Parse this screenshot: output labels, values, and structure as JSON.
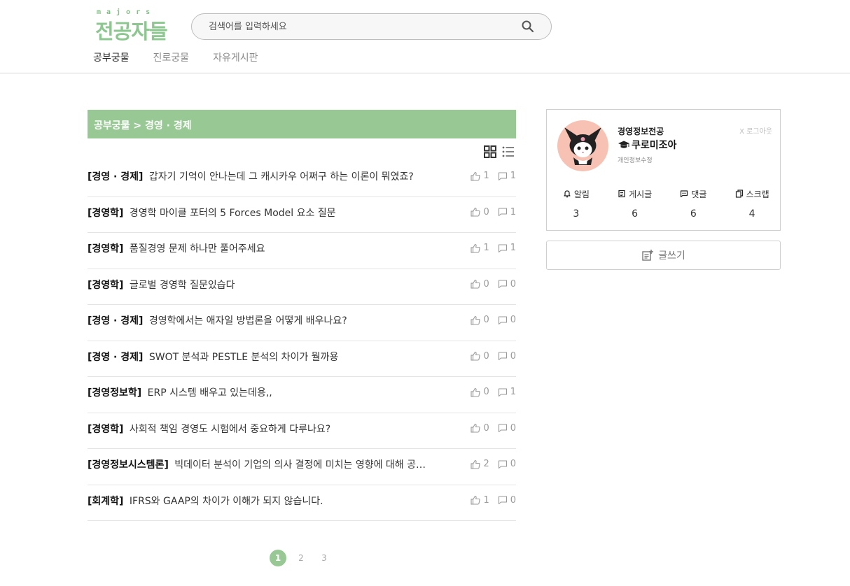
{
  "header": {
    "logo_sub": "majors",
    "logo_main": "전공자들",
    "search_placeholder": "검색어를 입력하세요"
  },
  "nav": [
    {
      "label": "공부궁물",
      "active": true
    },
    {
      "label": "진로궁물",
      "active": false
    },
    {
      "label": "자유게시판",
      "active": false
    }
  ],
  "board": {
    "breadcrumb": "공부궁물 > 경영 · 경제"
  },
  "posts": [
    {
      "category": "[경영 · 경제]",
      "title": "갑자기 기억이 안나는데 그 캐시카우 어쩌구 하는 이론이 뭐였죠?",
      "likes": "1",
      "comments": "1"
    },
    {
      "category": "[경영학]",
      "title": "경영학 마이클 포터의 5 Forces Model 요소 질문",
      "likes": "0",
      "comments": "1"
    },
    {
      "category": "[경영학]",
      "title": "품질경영 문제 하나만 풀어주세요",
      "likes": "1",
      "comments": "1"
    },
    {
      "category": "[경영학]",
      "title": "글로벌 경영학 질문있습다",
      "likes": "0",
      "comments": "0"
    },
    {
      "category": "[경영 · 경제]",
      "title": "경영학에서는 애자일 방법론을 어떻게 배우나요?",
      "likes": "0",
      "comments": "0"
    },
    {
      "category": "[경영 · 경제]",
      "title": "SWOT 분석과 PESTLE 분석의 차이가 뭘까용",
      "likes": "0",
      "comments": "0"
    },
    {
      "category": "[경영정보학]",
      "title": "ERP 시스템 배우고 있는데용,,",
      "likes": "0",
      "comments": "1"
    },
    {
      "category": "[경영학]",
      "title": "사회적 책임 경영도 시험에서 중요하게 다루나요?",
      "likes": "0",
      "comments": "0"
    },
    {
      "category": "[경영정보시스템론]",
      "title": "빅데이터 분석이 기업의 의사 결정에 미치는 영향에 대해 공…",
      "likes": "2",
      "comments": "0"
    },
    {
      "category": "[회계학]",
      "title": "IFRS와 GAAP의 차이가 이해가 되지 않습니다.",
      "likes": "1",
      "comments": "0"
    }
  ],
  "pagination": [
    "1",
    "2",
    "3"
  ],
  "profile": {
    "major": "경영정보전공",
    "nickname": "쿠로미조아",
    "edit_label": "개인정보수정",
    "logout_label": "X 로그아웃",
    "stats": [
      {
        "label": "알림",
        "count": "3",
        "icon": "bell-icon"
      },
      {
        "label": "게시글",
        "count": "6",
        "icon": "document-icon"
      },
      {
        "label": "댓글",
        "count": "6",
        "icon": "comment-icon"
      },
      {
        "label": "스크랩",
        "count": "4",
        "icon": "scrap-icon"
      }
    ]
  },
  "write_button": "글쓰기",
  "colors": {
    "accent": "#98c994",
    "logo": "#8cc78f",
    "avatar_bg": "#f7c2b3"
  }
}
